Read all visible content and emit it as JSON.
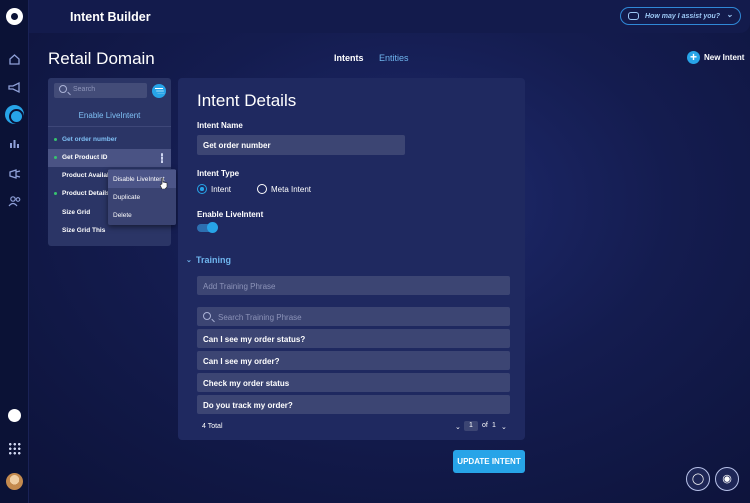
{
  "app": {
    "title": "Intent Builder"
  },
  "assistant": {
    "placeholder": "How may I assist you?"
  },
  "page": {
    "title": "Retail Domain",
    "tabs": [
      {
        "label": "Intents",
        "active": true
      },
      {
        "label": "Entities",
        "active": false
      }
    ],
    "new_intent_label": "New Intent"
  },
  "sidebar": {
    "icons": [
      "logo-icon",
      "home-icon",
      "megaphone-icon",
      "bot-icon",
      "bar-chart-icon",
      "announce-icon",
      "users-icon",
      "clock-icon",
      "apps-grid-icon",
      "user-avatar"
    ]
  },
  "intents_list": {
    "search_placeholder": "Search",
    "enable_liveintent_label": "Enable LiveIntent",
    "items": [
      {
        "label": "Get order number",
        "live": true
      },
      {
        "label": "Get Product ID",
        "live": true,
        "selected": true
      },
      {
        "label": "Product Availability",
        "live": false
      },
      {
        "label": "Product Details",
        "live": true
      },
      {
        "label": "Size Grid",
        "live": false
      },
      {
        "label": "Size Grid This",
        "live": false
      }
    ],
    "context_menu": [
      "Disable LiveIntent",
      "Duplicate",
      "Delete"
    ]
  },
  "details": {
    "heading": "Intent Details",
    "name_label": "Intent Name",
    "name_value": "Get order number",
    "type_label": "Intent Type",
    "type_options": [
      {
        "label": "Intent",
        "selected": true
      },
      {
        "label": "Meta Intent",
        "selected": false
      }
    ],
    "liveintent_label": "Enable LiveIntent",
    "liveintent_on": true,
    "training_label": "Training",
    "add_phrase_placeholder": "Add Training Phrase",
    "search_phrase_placeholder": "Search Training Phrase",
    "phrases": [
      "Can I see my order status?",
      "Can I see my order?",
      "Check my order status",
      "Do you track my order?"
    ],
    "total": "4 Total",
    "page_current": "1",
    "page_of": "of",
    "page_total": "1"
  },
  "actions": {
    "update_label": "UPDATE INTENT"
  },
  "colors": {
    "accent": "#27a4e8",
    "live_dot": "#37c46f",
    "link": "#6fb5ee"
  }
}
